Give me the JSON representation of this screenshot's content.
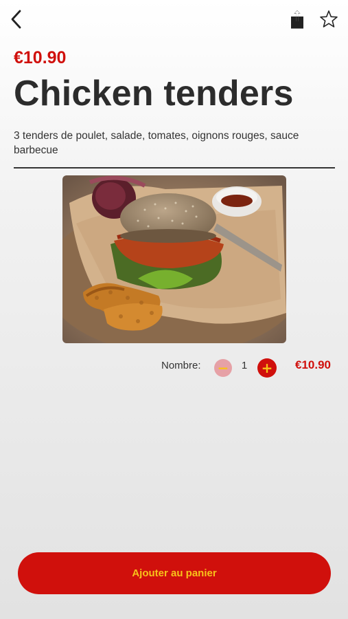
{
  "header": {
    "back_icon": "chevron-left-icon",
    "share_icon": "share-icon",
    "favorite_icon": "star-outline-icon"
  },
  "product": {
    "price": "€10.90",
    "name": "Chicken tenders",
    "description": "3 tenders de poulet, salade, tomates, oignons rouges, sauce barbecue",
    "image_icon": "burger-photo"
  },
  "quantity": {
    "label": "Nombre:",
    "minus_symbol": "−",
    "value": "1",
    "plus_symbol": "+",
    "total": "€10.90"
  },
  "cart": {
    "add_label": "Ajouter au panier"
  },
  "colors": {
    "accent_red": "#d0100c",
    "accent_yellow": "#f8c21a",
    "minus_disabled": "#e6a1a6"
  }
}
